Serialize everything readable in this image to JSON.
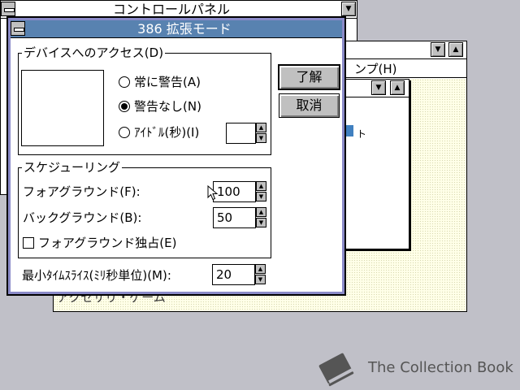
{
  "control_panel": {
    "title": "コントロールパネル"
  },
  "back_window": {
    "menu_help": "ンプ(H)",
    "partial_text": "ト",
    "bottom_partial": "アクセサリ・ゲーム"
  },
  "dialog": {
    "title": "386 拡張モード",
    "device_group": {
      "legend": "デバイスへのアクセス(D)",
      "options": [
        {
          "label": "常に警告(A)",
          "selected": false
        },
        {
          "label": "警告なし(N)",
          "selected": true
        },
        {
          "label": "ｱｲﾄﾞﾙ(秒)(I)",
          "selected": false
        }
      ],
      "idle_value": ""
    },
    "schedule_group": {
      "legend": "スケジューリング",
      "foreground_label": "フォアグラウンド(F):",
      "foreground_value": "100",
      "background_label": "バックグラウンド(B):",
      "background_value": "50",
      "exclusive_label": "フォアグラウンド独占(E)",
      "exclusive_checked": false
    },
    "timeslice_label": "最小ﾀｲﾑｽﾗｲｽ(ﾐﾘ秒単位)(M):",
    "timeslice_value": "20",
    "ok_label": "了解",
    "cancel_label": "取消"
  },
  "watermark": {
    "text": "The Collection Book",
    "icon": "book-icon"
  }
}
